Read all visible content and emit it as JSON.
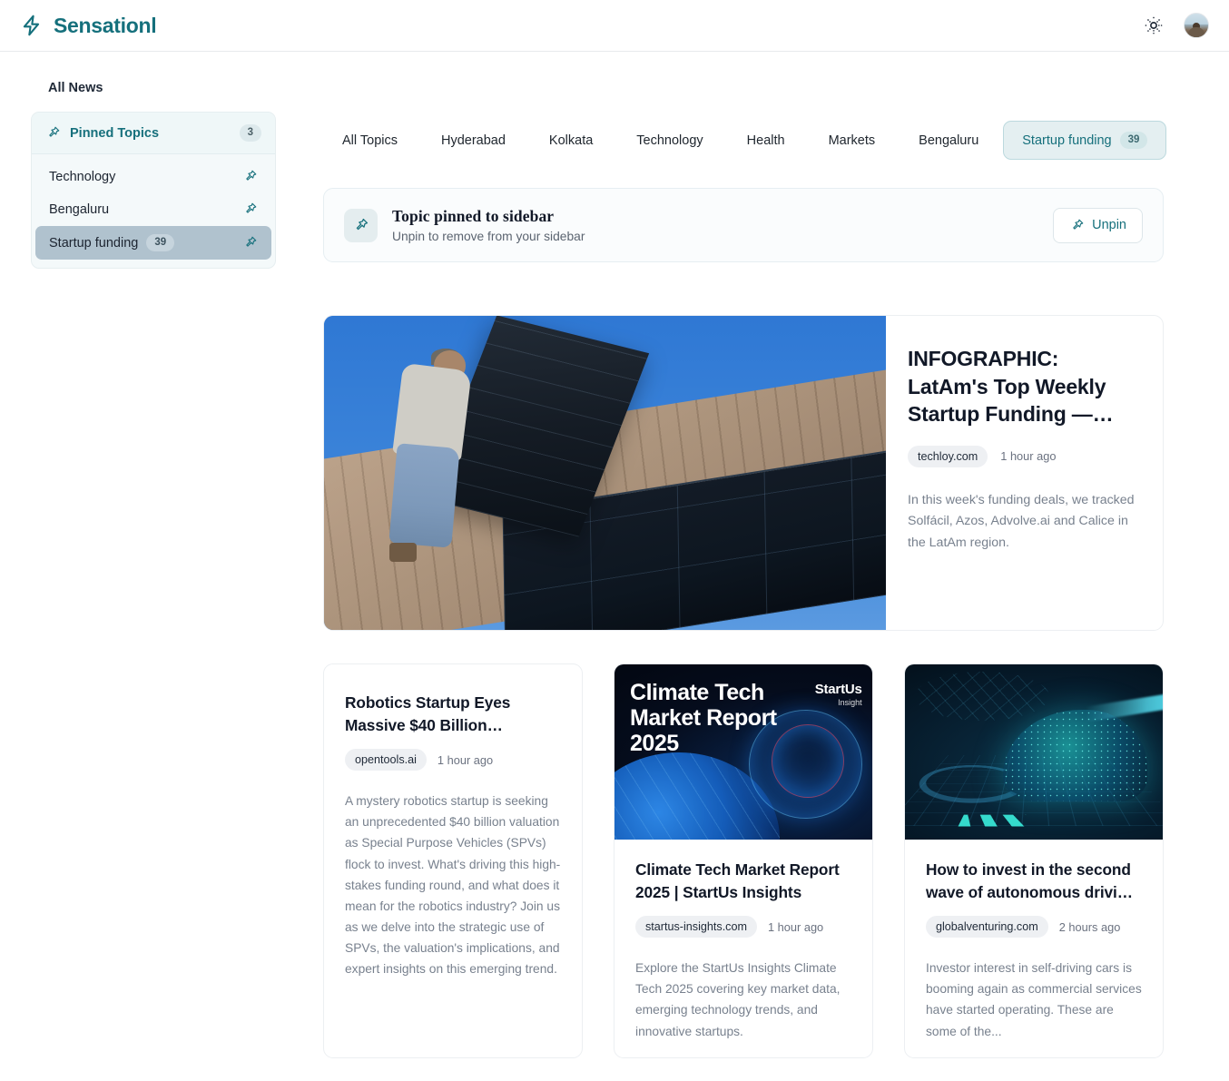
{
  "app": {
    "brand_name": "Sensationl",
    "brand_icon": "lightning-bolt-icon",
    "theme_toggle_icon": "sun-icon",
    "avatar_icon": "user-avatar"
  },
  "sidebar": {
    "title": "All News",
    "pinned_header": {
      "label": "Pinned Topics",
      "count": "3",
      "icon": "pin-icon"
    },
    "items": [
      {
        "label": "Technology",
        "count": "",
        "selected": false,
        "icon": "pin-icon"
      },
      {
        "label": "Bengaluru",
        "count": "",
        "selected": false,
        "icon": "pin-icon"
      },
      {
        "label": "Startup funding",
        "count": "39",
        "selected": true,
        "icon": "pin-icon"
      }
    ]
  },
  "tabs": [
    {
      "label": "All Topics",
      "count": "",
      "active": false
    },
    {
      "label": "Hyderabad",
      "count": "",
      "active": false
    },
    {
      "label": "Kolkata",
      "count": "",
      "active": false
    },
    {
      "label": "Technology",
      "count": "",
      "active": false
    },
    {
      "label": "Health",
      "count": "",
      "active": false
    },
    {
      "label": "Markets",
      "count": "",
      "active": false
    },
    {
      "label": "Bengaluru",
      "count": "",
      "active": false
    },
    {
      "label": "Startup funding",
      "count": "39",
      "active": true
    }
  ],
  "banner": {
    "icon": "pin-icon",
    "title": "Topic pinned to sidebar",
    "subtitle": "Unpin to remove from your sidebar",
    "button_label": "Unpin",
    "button_icon": "pin-icon"
  },
  "feature": {
    "title": "INFOGRAPHIC: LatAm's Top Weekly Startup Funding —…",
    "source": "techloy.com",
    "time": "1 hour ago",
    "excerpt": "In this week's funding deals, we tracked Solfácil, Azos, Advolve.ai and Calice in the LatAm region.",
    "image_alt": "worker installing solar panel on roof under blue sky"
  },
  "cards": [
    {
      "title": "Robotics Startup Eyes Massive $40 Billion…",
      "source": "opentools.ai",
      "time": "1 hour ago",
      "excerpt": "A mystery robotics startup is seeking an unprecedented $40 billion valuation as Special Purpose Vehicles (SPVs) flock to invest. What's driving this high-stakes funding round, and what does it mean for the robotics industry? Join us as we delve into the strategic use of SPVs, the valuation's implications, and expert insights on this emerging trend.",
      "has_image": false
    },
    {
      "title": "Climate Tech Market Report 2025 | StartUs Insights",
      "source": "startus-insights.com",
      "time": "1 hour ago",
      "excerpt": "Explore the StartUs Insights Climate Tech 2025 covering key market data, emerging technology trends, and innovative startups.",
      "has_image": true,
      "image_overlay_title": "Climate Tech Market Report 2025",
      "image_brand_line1": "StartUs",
      "image_brand_line2": "Insight"
    },
    {
      "title": "How to invest in the second wave of autonomous drivi…",
      "source": "globalventuring.com",
      "time": "2 hours ago",
      "excerpt": "Investor interest in self-driving cars is booming again as commercial services have started operating. These are some of the...",
      "has_image": true,
      "image_alt": "wireframe autonomous car on dark blue grid"
    }
  ],
  "colors": {
    "accent": "#16707c",
    "selected_sidebar_bg": "#b0c2ce",
    "active_tab_bg": "#e4eff1",
    "text_primary": "#111827",
    "text_muted": "#78818e"
  }
}
